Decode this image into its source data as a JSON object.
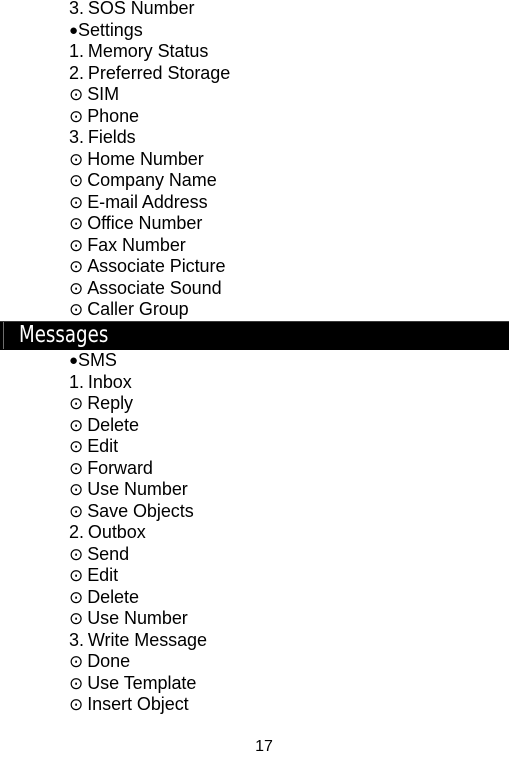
{
  "document": {
    "page_number": "17",
    "markers": {
      "group": "●",
      "leaf": "⊙"
    }
  },
  "sections": [
    {
      "id": "phonebook-continued",
      "has_banner": false,
      "banner_title": "",
      "items": [
        {
          "marker": "num",
          "num": "3.",
          "label": "SOS Number"
        },
        {
          "marker": "bullet",
          "num": "",
          "label": "Settings"
        },
        {
          "marker": "num",
          "num": "1.",
          "label": "Memory Status"
        },
        {
          "marker": "num",
          "num": "2.",
          "label": "Preferred Storage"
        },
        {
          "marker": "circledot",
          "num": "",
          "label": "SIM"
        },
        {
          "marker": "circledot",
          "num": "",
          "label": "Phone"
        },
        {
          "marker": "num",
          "num": "3.",
          "label": "Fields"
        },
        {
          "marker": "circledot",
          "num": "",
          "label": "Home Number"
        },
        {
          "marker": "circledot",
          "num": "",
          "label": "Company Name"
        },
        {
          "marker": "circledot",
          "num": "",
          "label": "E-mail Address"
        },
        {
          "marker": "circledot",
          "num": "",
          "label": "Office Number"
        },
        {
          "marker": "circledot",
          "num": "",
          "label": "Fax Number"
        },
        {
          "marker": "circledot",
          "num": "",
          "label": "Associate Picture"
        },
        {
          "marker": "circledot",
          "num": "",
          "label": "Associate Sound"
        },
        {
          "marker": "circledot",
          "num": "",
          "label": "Caller Group"
        }
      ]
    },
    {
      "id": "messages",
      "has_banner": true,
      "banner_title": "Messages",
      "items": [
        {
          "marker": "bullet",
          "num": "",
          "label": "SMS"
        },
        {
          "marker": "num",
          "num": "1.",
          "label": "Inbox"
        },
        {
          "marker": "circledot",
          "num": "",
          "label": "Reply"
        },
        {
          "marker": "circledot",
          "num": "",
          "label": "Delete"
        },
        {
          "marker": "circledot",
          "num": "",
          "label": "Edit"
        },
        {
          "marker": "circledot",
          "num": "",
          "label": "Forward"
        },
        {
          "marker": "circledot",
          "num": "",
          "label": "Use Number"
        },
        {
          "marker": "circledot",
          "num": "",
          "label": "Save Objects"
        },
        {
          "marker": "num",
          "num": "2.",
          "label": "Outbox"
        },
        {
          "marker": "circledot",
          "num": "",
          "label": "Send"
        },
        {
          "marker": "circledot",
          "num": "",
          "label": "Edit"
        },
        {
          "marker": "circledot",
          "num": "",
          "label": "Delete"
        },
        {
          "marker": "circledot",
          "num": "",
          "label": "Use Number"
        },
        {
          "marker": "num",
          "num": "3.",
          "label": "Write Message"
        },
        {
          "marker": "circledot",
          "num": "",
          "label": "Done"
        },
        {
          "marker": "circledot",
          "num": "",
          "label": "Use Template"
        },
        {
          "marker": "circledot",
          "num": "",
          "label": "Insert Object"
        }
      ]
    }
  ]
}
